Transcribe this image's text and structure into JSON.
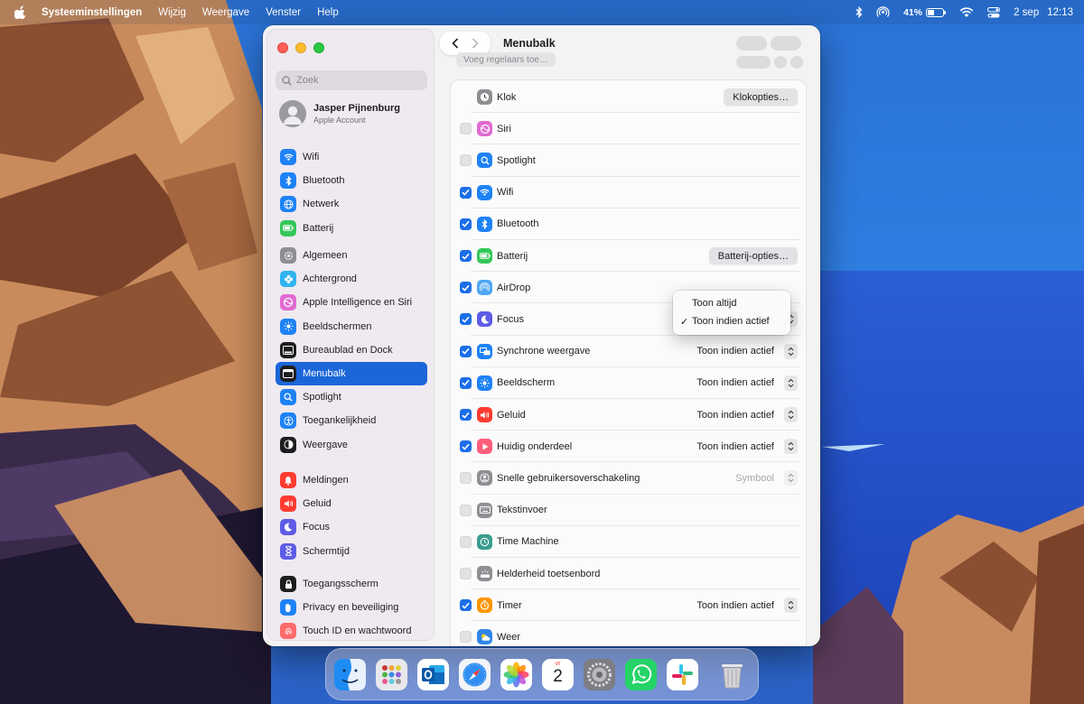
{
  "menubar": {
    "app_name": "Systeeminstellingen",
    "menus": [
      "Wijzig",
      "Weergave",
      "Venster",
      "Help"
    ],
    "battery_percent": "41%",
    "battery_level": 0.41,
    "date": "2 sep",
    "time": "12:13"
  },
  "window": {
    "title": "Menubalk",
    "search_placeholder": "Zoek",
    "account": {
      "name": "Jasper Pijnenburg",
      "subtitle": "Apple Account"
    },
    "ghost_button_label": "Voeg regelaars toe…"
  },
  "sidebar": {
    "groups": [
      [
        {
          "label": "Wifi",
          "icon": "wifi-icon",
          "color": "#1e82f6"
        },
        {
          "label": "Bluetooth",
          "icon": "bluetooth-icon",
          "color": "#1e82f6"
        },
        {
          "label": "Netwerk",
          "icon": "globe-icon",
          "color": "#1e82f6"
        },
        {
          "label": "Batterij",
          "icon": "battery-icon",
          "color": "#34c759"
        }
      ],
      [
        {
          "label": "Algemeen",
          "icon": "gear-icon",
          "color": "#8e8e93"
        },
        {
          "label": "Achtergrond",
          "icon": "flower-icon",
          "color": "#2fb4f0"
        },
        {
          "label": "Apple Intelligence en Siri",
          "icon": "siri-icon",
          "color": "#e06bd0"
        },
        {
          "label": "Beeldschermen",
          "icon": "sun-icon",
          "color": "#1e82f6"
        },
        {
          "label": "Bureaublad en Dock",
          "icon": "dock-icon",
          "color": "#1d1d1f"
        },
        {
          "label": "Menubalk",
          "icon": "menubar-icon",
          "color": "#1d1d1f",
          "selected": true
        },
        {
          "label": "Spotlight",
          "icon": "search-icon",
          "color": "#1e82f6"
        },
        {
          "label": "Toegankelijkheid",
          "icon": "accessibility-icon",
          "color": "#1e82f6"
        },
        {
          "label": "Weergave",
          "icon": "appearance-icon",
          "color": "#1d1d1f"
        }
      ],
      [
        {
          "label": "Meldingen",
          "icon": "bell-icon",
          "color": "#ff3b30"
        },
        {
          "label": "Geluid",
          "icon": "speaker-icon",
          "color": "#ff3b30"
        },
        {
          "label": "Focus",
          "icon": "moon-icon",
          "color": "#5e5ce6"
        },
        {
          "label": "Schermtijd",
          "icon": "hourglass-icon",
          "color": "#5e5ce6"
        }
      ],
      [
        {
          "label": "Toegangsscherm",
          "icon": "lock-icon",
          "color": "#1d1d1f"
        },
        {
          "label": "Privacy en beveiliging",
          "icon": "hand-icon",
          "color": "#1e82f6"
        },
        {
          "label": "Touch ID en wachtwoord",
          "icon": "fingerprint-icon",
          "color": "#ff6b6b"
        }
      ]
    ]
  },
  "menubar_items": [
    {
      "label": "Klok",
      "icon": "clock-icon",
      "color": "#8e8e93",
      "checkbox": "none",
      "button": "Klokopties…"
    },
    {
      "label": "Siri",
      "icon": "siri-icon",
      "color": "#e06bd0",
      "checkbox": "off"
    },
    {
      "label": "Spotlight",
      "icon": "search-icon",
      "color": "#1e82f6",
      "checkbox": "off"
    },
    {
      "label": "Wifi",
      "icon": "wifi-icon",
      "color": "#1e82f6",
      "checkbox": "on"
    },
    {
      "label": "Bluetooth",
      "icon": "bluetooth-icon",
      "color": "#1e82f6",
      "checkbox": "on"
    },
    {
      "label": "Batterij",
      "icon": "battery-icon",
      "color": "#34c759",
      "checkbox": "on",
      "button": "Batterij-opties…"
    },
    {
      "label": "AirDrop",
      "icon": "airdrop-icon",
      "color": "#4fa7f5",
      "checkbox": "on"
    },
    {
      "label": "Focus",
      "icon": "moon-icon",
      "color": "#5e5ce6",
      "checkbox": "on",
      "popup": "Toon indien actief",
      "popup_open": true
    },
    {
      "label": "Synchrone weergave",
      "icon": "mirror-icon",
      "color": "#1e82f6",
      "checkbox": "on",
      "popup": "Toon indien actief"
    },
    {
      "label": "Beeldscherm",
      "icon": "sun-icon",
      "color": "#1e82f6",
      "checkbox": "on",
      "popup": "Toon indien actief"
    },
    {
      "label": "Geluid",
      "icon": "speaker-icon",
      "color": "#ff3b30",
      "checkbox": "on",
      "popup": "Toon indien actief"
    },
    {
      "label": "Huidig onderdeel",
      "icon": "nowplaying-icon",
      "color": "#ff5e7a",
      "checkbox": "on",
      "popup": "Toon indien actief"
    },
    {
      "label": "Snelle gebruikersoverschakeling",
      "icon": "user-icon",
      "color": "#8e8e93",
      "checkbox": "off",
      "popup": "Symbool",
      "popup_disabled": true
    },
    {
      "label": "Tekstinvoer",
      "icon": "keyboard-icon",
      "color": "#8e8e93",
      "checkbox": "off"
    },
    {
      "label": "Time Machine",
      "icon": "timemachine-icon",
      "color": "#3a9d8f",
      "checkbox": "off"
    },
    {
      "label": "Helderheid toetsenbord",
      "icon": "keyboard-brightness-icon",
      "color": "#8e8e93",
      "checkbox": "off"
    },
    {
      "label": "Timer",
      "icon": "timer-icon",
      "color": "#ff9500",
      "checkbox": "on",
      "popup": "Toon indien actief"
    },
    {
      "label": "Weer",
      "icon": "weather-icon",
      "color": "#2f86e6",
      "checkbox": "off"
    }
  ],
  "popup_menu": {
    "options": [
      "Toon altijd",
      "Toon indien actief"
    ],
    "selected_index": 1
  },
  "dock": {
    "apps": [
      {
        "name": "finder-icon",
        "color": "#1f8cf3"
      },
      {
        "name": "launchpad-icon",
        "color": "#e8e8ec"
      },
      {
        "name": "outlook-icon",
        "color": "#0f6cbd"
      },
      {
        "name": "safari-icon",
        "color": "#f2f4f8"
      },
      {
        "name": "photos-icon",
        "color": "#ffffff"
      },
      {
        "name": "calendar-icon",
        "color": "#ffffff",
        "label_top": "vr",
        "label_day": "2"
      },
      {
        "name": "system-settings-icon",
        "color": "#8e8e93"
      },
      {
        "name": "whatsapp-icon",
        "color": "#25d366"
      },
      {
        "name": "slack-icon",
        "color": "#ffffff"
      },
      {
        "name": "trash-icon",
        "color": "#c8c8cc"
      }
    ]
  }
}
